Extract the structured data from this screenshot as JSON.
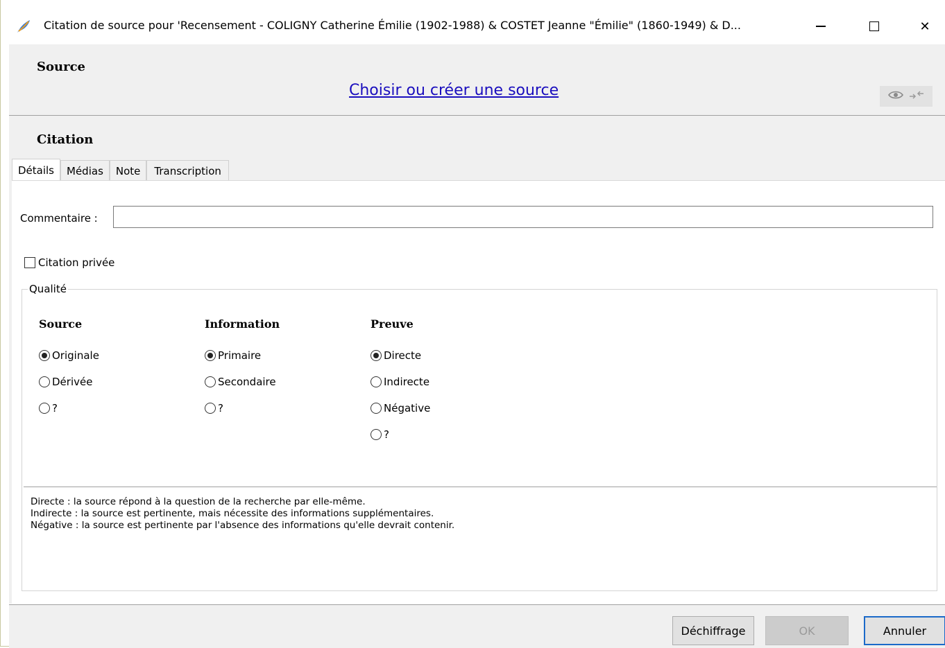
{
  "window": {
    "title": "Citation de source pour 'Recensement - COLIGNY Catherine Émilie (1902-1988) & COSTET Jeanne \"Émilie\" (1860-1949) & D...",
    "minimize_label": "—",
    "maximize_label": "☐",
    "close_label": "✕"
  },
  "source": {
    "heading": "Source",
    "choose_link": "Choisir ou créer une source"
  },
  "citation": {
    "heading": "Citation",
    "tabs": [
      {
        "label": "Détails",
        "active": true
      },
      {
        "label": "Médias",
        "active": false
      },
      {
        "label": "Note",
        "active": false
      },
      {
        "label": "Transcription",
        "active": false
      }
    ],
    "comment_label": "Commentaire :",
    "comment_value": "",
    "private_label": "Citation privée",
    "private_checked": false,
    "quality": {
      "legend": "Qualité",
      "columns": [
        {
          "title": "Source",
          "options": [
            "Originale",
            "Dérivée",
            "?"
          ],
          "selected": "Originale"
        },
        {
          "title": "Information",
          "options": [
            "Primaire",
            "Secondaire",
            "?"
          ],
          "selected": "Primaire"
        },
        {
          "title": "Preuve",
          "options": [
            "Directe",
            "Indirecte",
            "Négative",
            "?"
          ],
          "selected": "Directe"
        }
      ],
      "help_lines": [
        "Directe : la source répond à la question de la recherche par elle-même.",
        "Indirecte : la source est pertinente, mais nécessite des informations supplémentaires.",
        "Négative : la source est pertinente par l'absence des informations qu'elle devrait contenir."
      ]
    }
  },
  "footer": {
    "decipher_label": "Déchiffrage",
    "ok_label": "OK",
    "cancel_label": "Annuler"
  },
  "icons": {
    "app": "feather-icon",
    "eye": "eye-icon",
    "swap": "swap-arrows-icon"
  },
  "colors": {
    "link": "#1a0ebe",
    "default_button_border": "#1b6ac9"
  }
}
